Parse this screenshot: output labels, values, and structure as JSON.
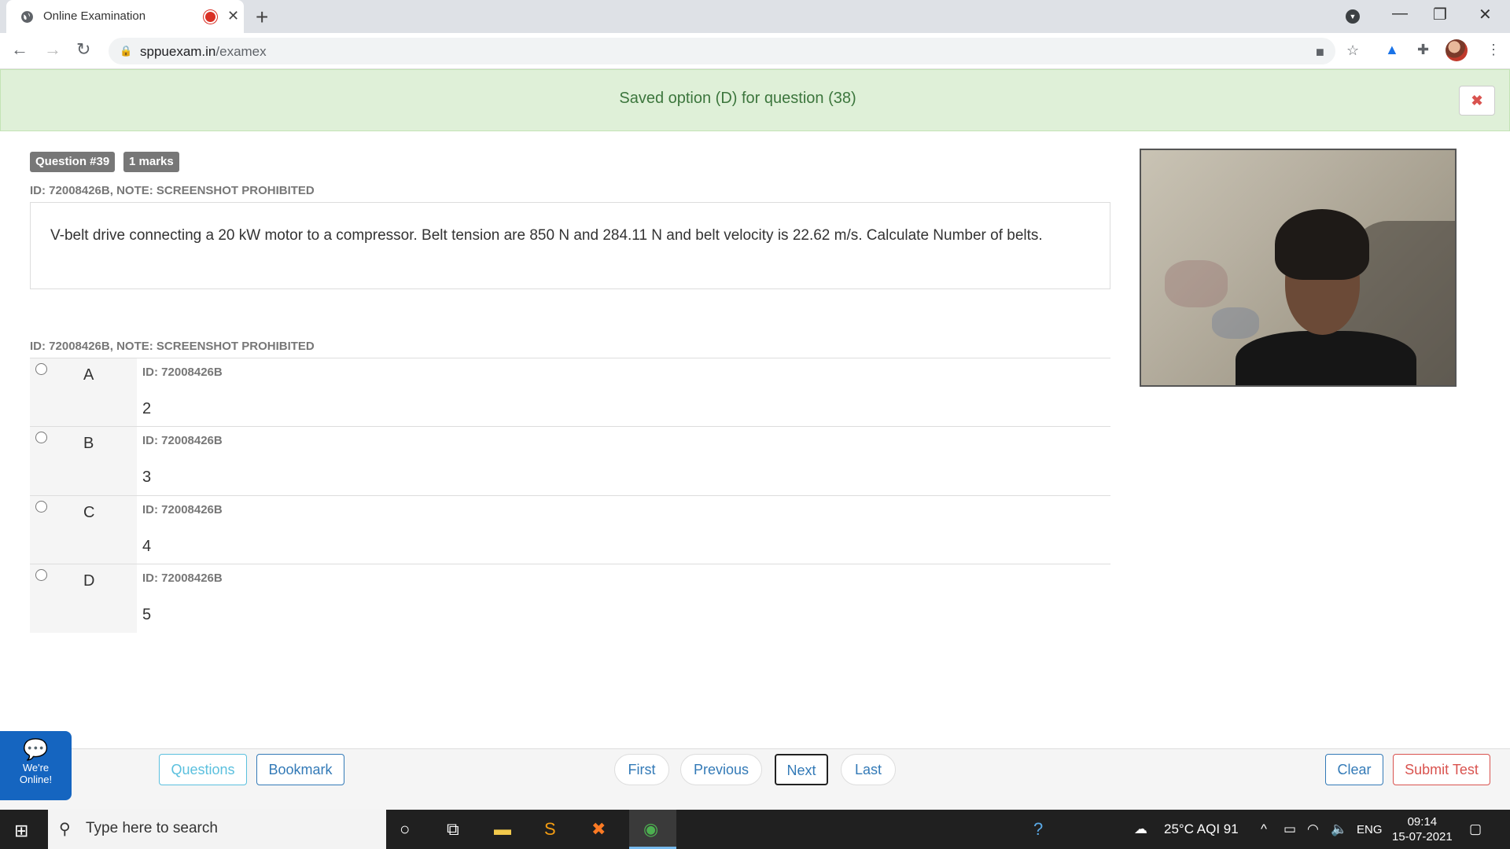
{
  "browser": {
    "tab_title": "Online Examination",
    "tab_close": "✕",
    "new_tab": "+",
    "url_host": "sppuexam.in",
    "url_path": "/examex",
    "window_controls": [
      "—",
      "❐",
      "✕"
    ]
  },
  "alert": {
    "message": "Saved option (D) for question (38)",
    "close_symbol": "✖"
  },
  "question": {
    "number_badge": "Question #39",
    "marks_badge": "1 marks",
    "id_note": "ID: 72008426B, NOTE: SCREENSHOT PROHIBITED",
    "text": "V-belt drive connecting a 20 kW motor to a compressor. Belt tension are 850 N and 284.11 N and belt velocity is 22.62 m/s. Calculate Number of belts.",
    "options_note": "ID: 72008426B, NOTE: SCREENSHOT PROHIBITED",
    "options": [
      {
        "letter": "A",
        "id": "ID: 72008426B",
        "value": "2"
      },
      {
        "letter": "B",
        "id": "ID: 72008426B",
        "value": "3"
      },
      {
        "letter": "C",
        "id": "ID: 72008426B",
        "value": "4"
      },
      {
        "letter": "D",
        "id": "ID: 72008426B",
        "value": "5"
      }
    ]
  },
  "footer": {
    "questions": "Questions",
    "bookmark": "Bookmark",
    "first": "First",
    "previous": "Previous",
    "next": "Next",
    "last": "Last",
    "clear": "Clear",
    "submit": "Submit Test"
  },
  "chat": {
    "label_line1": "We're",
    "label_line2": "Online!"
  },
  "taskbar": {
    "search_placeholder": "Type here to search",
    "weather": "25°C  AQI 91",
    "language": "ENG",
    "time": "09:14",
    "date": "15-07-2021"
  },
  "colors": {
    "alert_bg": "#dff0d8",
    "alert_text": "#3c763d",
    "primary": "#337ab7",
    "danger": "#d9534f",
    "badge": "#777777"
  }
}
